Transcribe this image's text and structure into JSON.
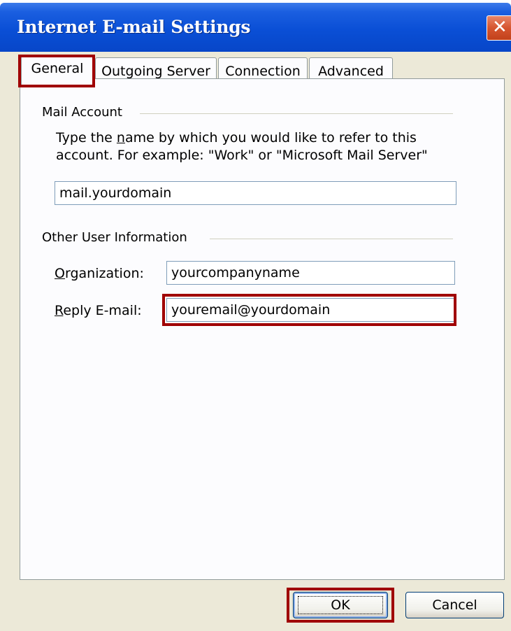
{
  "window": {
    "title": "Internet E-mail Settings",
    "close_glyph": "✕"
  },
  "tabs": [
    {
      "label": "General",
      "active": true
    },
    {
      "label": "Outgoing Server",
      "active": false
    },
    {
      "label": "Connection",
      "active": false
    },
    {
      "label": "Advanced",
      "active": false
    }
  ],
  "mail_account": {
    "group_label": "Mail Account",
    "description_pre": "Type the ",
    "description_key": "n",
    "description_post": "ame by which you would like to refer to this account.  For example: \"Work\" or \"Microsoft Mail Server\"",
    "account_name_value": "mail.yourdomain"
  },
  "other_info": {
    "group_label": "Other User Information",
    "organization_key": "O",
    "organization_rest": "rganization:",
    "organization_value": "yourcompanyname",
    "reply_key": "R",
    "reply_rest": "eply E-mail:",
    "reply_value": "youremail@yourdomain"
  },
  "buttons": {
    "ok": "OK",
    "cancel": "Cancel"
  },
  "colors": {
    "highlight": "#a00000",
    "titlebar": "#0a4fd6",
    "face": "#ece9d8"
  }
}
